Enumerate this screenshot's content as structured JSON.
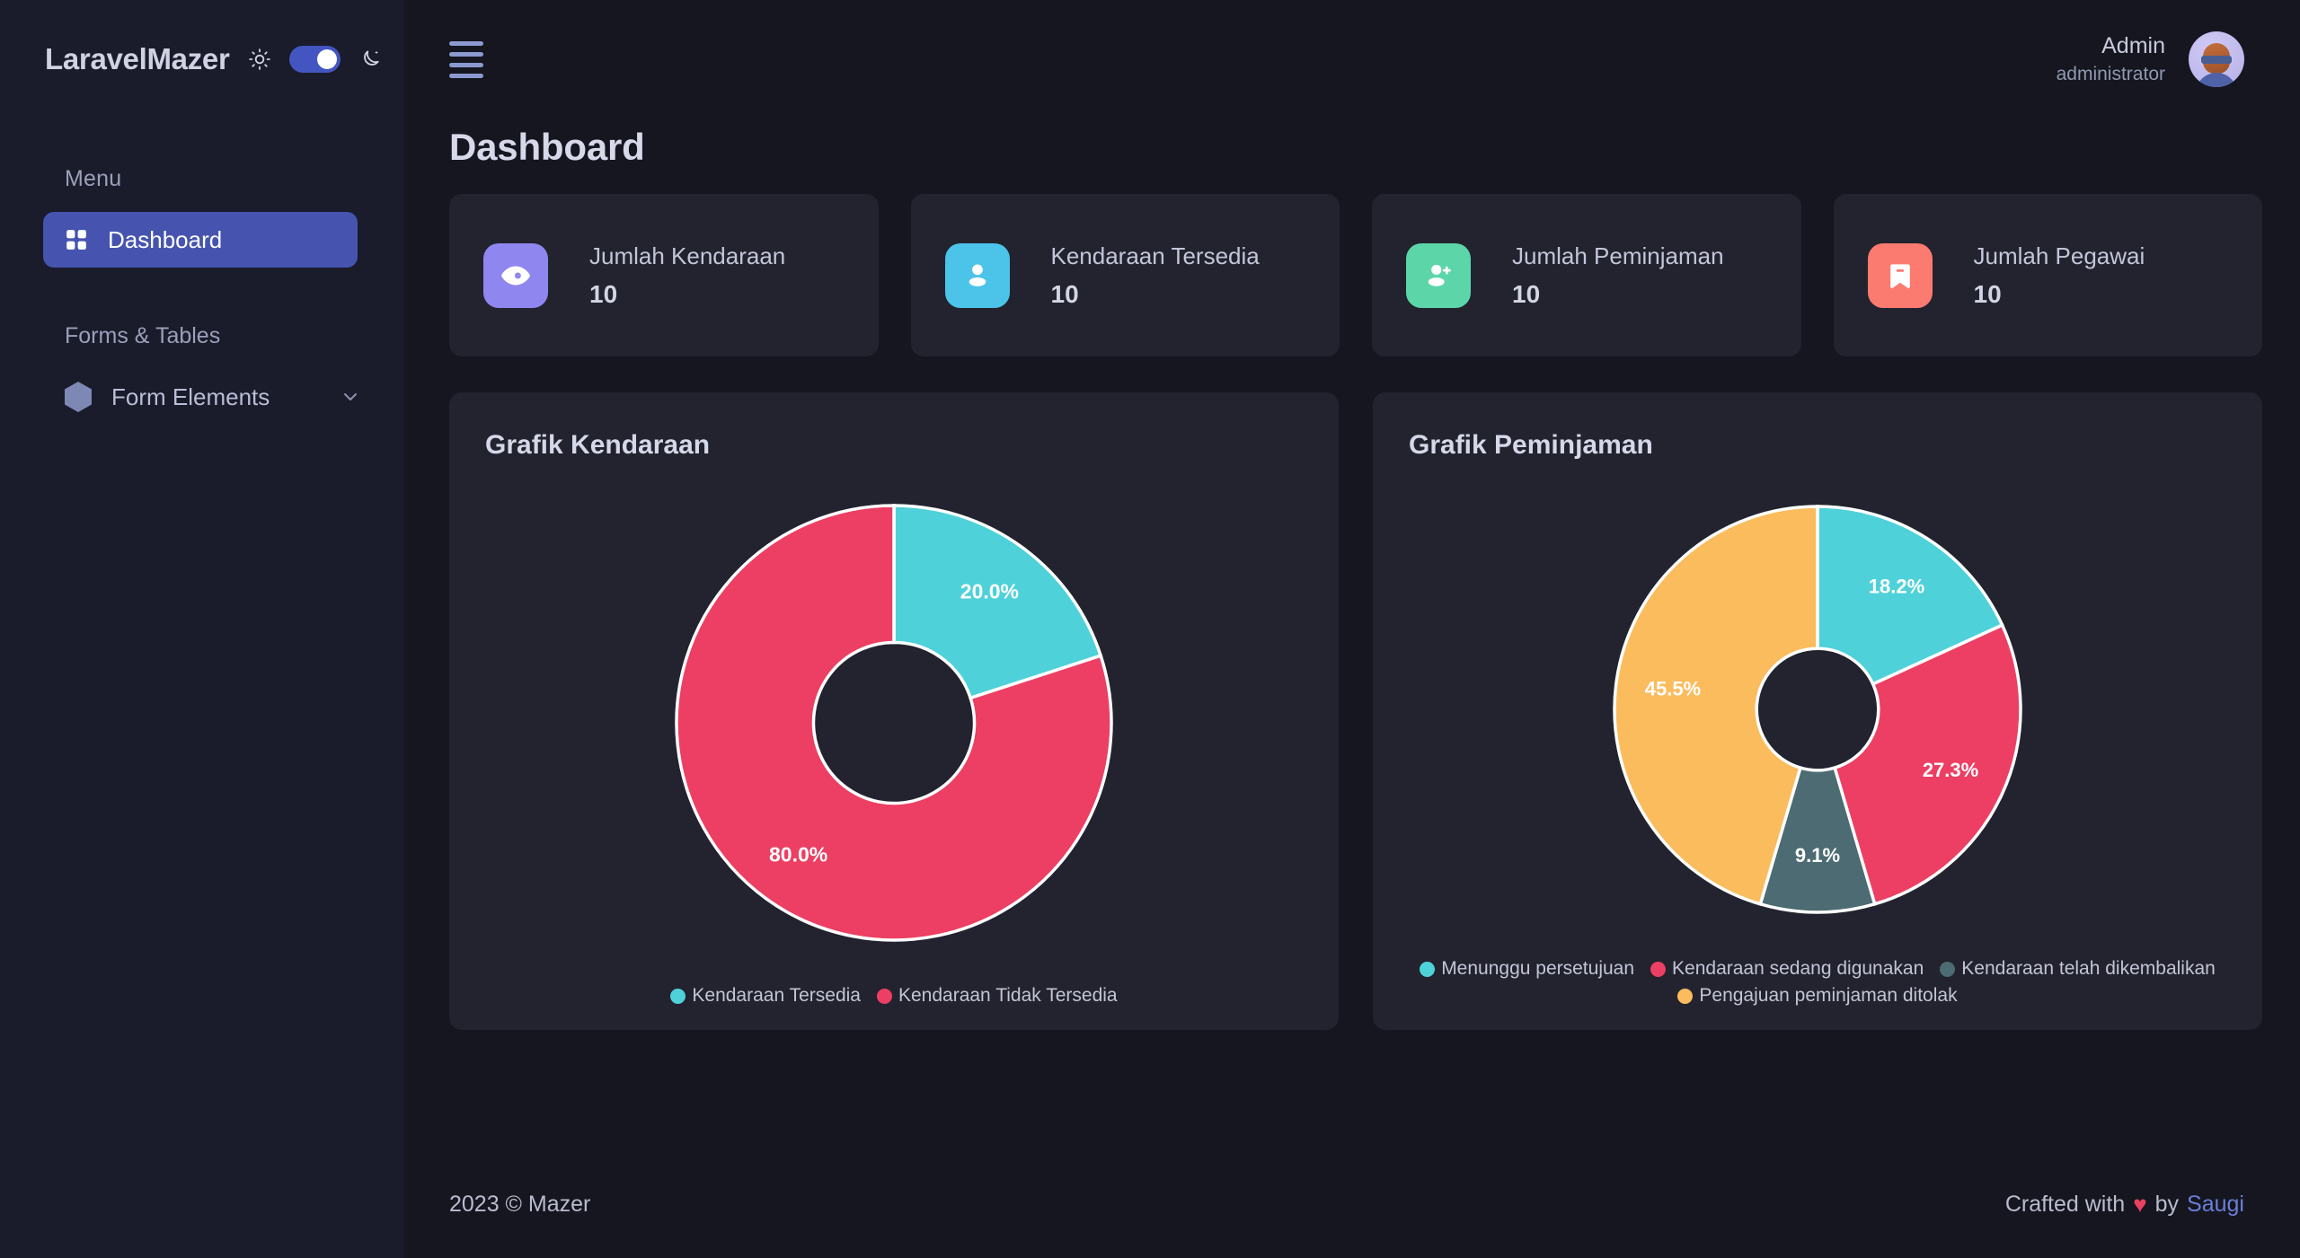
{
  "sidebar": {
    "brand": "LaravelMazer",
    "theme": {
      "light_icon": "sun-icon",
      "dark_icon": "moon-icon",
      "toggle_on": true,
      "accent": "#4355c0"
    },
    "menu_label": "Menu",
    "items": [
      {
        "label": "Dashboard",
        "icon": "grid-icon",
        "active": true
      }
    ],
    "group_label": "Forms & Tables",
    "sub_items": [
      {
        "label": "Form Elements",
        "icon": "hexagon-icon",
        "chevron": "chevron-down-icon"
      }
    ]
  },
  "topbar": {
    "menu_toggle_icon": "hamburger-icon",
    "user": {
      "name": "Admin",
      "role": "administrator",
      "avatar": "user-avatar"
    }
  },
  "page": {
    "title": "Dashboard"
  },
  "stats": [
    {
      "label": "Jumlah Kendaraan",
      "value": "10",
      "icon": "eye-icon",
      "color": "#9086f0"
    },
    {
      "label": "Kendaraan Tersedia",
      "value": "10",
      "icon": "user-icon",
      "color": "#4cc3e8"
    },
    {
      "label": "Jumlah Peminjaman",
      "value": "10",
      "icon": "user-plus-icon",
      "color": "#5cd6a9"
    },
    {
      "label": "Jumlah Pegawai",
      "value": "10",
      "icon": "bookmark-icon",
      "color": "#fb7b70"
    }
  ],
  "charts": [
    {
      "title": "Grafik Kendaraan",
      "chart_data": {
        "type": "pie",
        "title": "Grafik Kendaraan",
        "labels": [
          "Kendaraan Tersedia",
          "Kendaraan Tidak Tersedia"
        ],
        "values": [
          20.0,
          80.0
        ],
        "value_labels": [
          "20.0%",
          "80.0%"
        ],
        "colors": [
          "#4fd1d9",
          "#ec3f63"
        ],
        "donut": true,
        "inner_radius_ratio": 0.37,
        "start_angle": 0,
        "legend": "bottom"
      }
    },
    {
      "title": "Grafik Peminjaman",
      "chart_data": {
        "type": "pie",
        "title": "Grafik Peminjaman",
        "labels": [
          "Menunggu persetujuan",
          "Kendaraan sedang digunakan",
          "Kendaraan telah dikembalikan",
          "Pengajuan peminjaman ditolak"
        ],
        "values": [
          18.2,
          27.3,
          9.1,
          45.5
        ],
        "value_labels": [
          "18.2%",
          "27.3%",
          "9.1%",
          "45.5%"
        ],
        "colors": [
          "#4fd1d9",
          "#ec3f63",
          "#4c6b72",
          "#fbbc5e"
        ],
        "donut": true,
        "inner_radius_ratio": 0.3,
        "start_angle": 0,
        "legend": "bottom"
      }
    }
  ],
  "footer": {
    "left": "2023 © Mazer",
    "right_prefix": "Crafted with",
    "heart": "♥",
    "right_mid": "by",
    "author": "Saugi"
  }
}
